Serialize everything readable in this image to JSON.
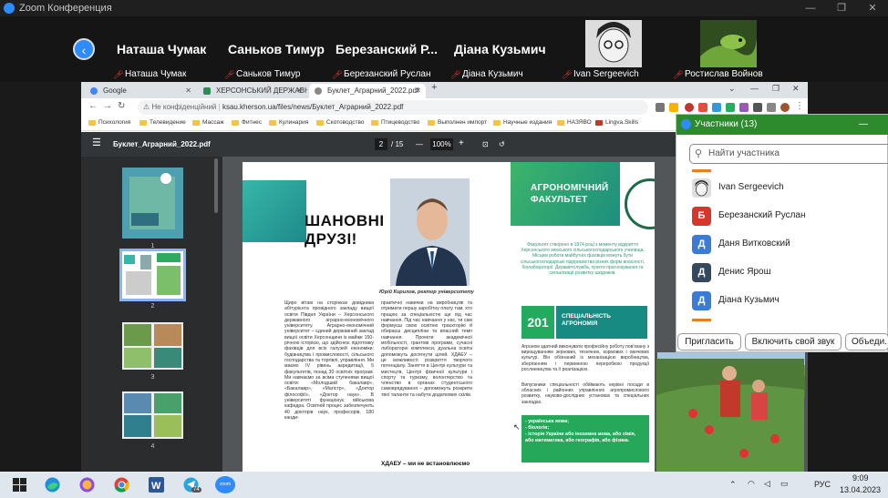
{
  "zoom": {
    "title": "Zoom Конференция"
  },
  "gallery": {
    "tiles": [
      {
        "big": "Наташа Чумак",
        "small": "Наташа Чумак"
      },
      {
        "big": "Саньков Тимур",
        "small": "Саньков Тимур"
      },
      {
        "big": "Березанский  Р...",
        "small": "Березанский Руслан"
      },
      {
        "big": "Діана Кузьмич",
        "small": "Діана Кузьмич"
      },
      {
        "big": "",
        "small": "Ivan Sergeevich"
      },
      {
        "big": "",
        "small": "Ростислав Войнов"
      }
    ]
  },
  "browser": {
    "tabs": [
      {
        "label": "Google"
      },
      {
        "label": "ХЕРСОНСЬКИЙ ДЕРЖАВНИЙ А..."
      },
      {
        "label": "Буклет_Аграрний_2022.pdf"
      }
    ],
    "address": {
      "security": "Не конфіденційний",
      "url": "ksau.kherson.ua/files/news/Буклет_Аграрний_2022.pdf"
    },
    "bookmarks": [
      "Психология",
      "Телевидение",
      "Массаж",
      "Фитнес",
      "Кулинария",
      "Скотоводство",
      "Птицеводство",
      "Выполнен импорт",
      "Научные издания",
      "НАЗЯВО",
      "Lingva.Skills"
    ]
  },
  "pdf": {
    "filename": "Буклет_Аграрний_2022.pdf",
    "current_page": "2",
    "total_pages": "/ 15",
    "zoom": "100%",
    "thumbnails": [
      "1",
      "2",
      "3",
      "4"
    ],
    "left": {
      "greeting_1": "ШАНОВНІ",
      "greeting_2": "ДРУЗІ!",
      "caption": "Юрій Кирилов, ректор університету",
      "col1": "Щиро вітаю на сторінках довідника абітурієнта провідного закладу вищої освіти Півдня України – Херсонського державного аграрно-економічного університету. Аграрно-економічний університет – єдиний державний заклад вищої освіти Херсонщини із майже 150-річною історією, що здійснює підготовку фахівців для всіх галузей економіки: будівництва і промисловості, сільського господарства та торгівлі, управління. Ми маємо IV рівень акредитації, 5 факультетів, понад 30 освітніх програм. Ми навчаємо за всіма ступенями вищої освіти: «Молодший бакалавр», «Бакалавр», «Магістр», «Доктор філософії», «Доктор наук». В університеті функціонує військова кафедра. Освітній процес забезпечують 40 докторів наук, професорів, 180 канди-",
      "col2": "практичні навички на виробництві та отримати першу заробітну плату там, хто працює за спеціальністю ще під час навчання. Під час навчання у нас, ти сам формуєш свою освітню траєкторію й обираєш дисципліни та власний темп навчання. Проекти академічної мобільності, грантові програми, сучасні лабораторні комплекси, дуальна освіта допоможуть досягнути цілей. ХДАЕУ – це можливості розкриття творчого потенціалу. Заняття в Центрі культури та мистецтв, Центрі фізичної культури і спорту та туризму, волонтерство та членство в органах студентського самоврядування – допоможуть розкрити твої таланти та набути додаткових скілів.",
      "bottom": "ХДАЕУ – ми не встановлюємо"
    },
    "right": {
      "faculty_1": "АГРОНОМІЧНИЙ",
      "faculty_2": "ФАКУЛЬТЕТ",
      "intro": "Факультет створено в 1874 році з моменту відкриття Херсонського земського сільськогосподарського училища. Місцем роботи майбутніх фахівців можуть бути сільськогосподарські підприємства різних форм власності, біолабораторії. Держветслужба, пункти прогнозування та сигналізації розвитку шкідників.",
      "spec_num": "201",
      "spec_1": "СПЕЦІАЛЬНІСТЬ",
      "spec_2": "АГРОНОМІЯ",
      "text1": "Агроном здатний виконувати професійну роботу пов'язану з вирощуванням зернових, технічних, кормових і овочевих культур. Він обізнаний із механізацією виробництва, зберіганням і первинною переробкою продукції рослинництва та її реалізацією.",
      "text2": "Випускники спеціальності обіймають керівні посади в обласних і районних управліннях агропромислового розвитку, науково-дослідних установах та спеціальних закладах.",
      "list_1": "- українська мова;",
      "list_2": "- біологія;",
      "list_3": "- історія України або іноземна мова, або хімія, або математика, або географія, або фізика."
    }
  },
  "participants": {
    "title": "Участники (13)",
    "search_placeholder": "Найти участника",
    "rows": [
      {
        "name": "Ivan Sergeevich",
        "initial": "",
        "color": "#444444"
      },
      {
        "name": "Березанский Руслан",
        "initial": "Б",
        "color": "#d9362b"
      },
      {
        "name": "Даня Витковский",
        "initial": "Д",
        "color": "#3a7bd5"
      },
      {
        "name": "Денис Ярош",
        "initial": "Д",
        "color": "#34495e"
      },
      {
        "name": "Діана Кузьмич",
        "initial": "Д",
        "color": "#3a7bd5"
      }
    ],
    "buttons": [
      "Пригласить",
      "Включить свой звук",
      "Объеди..."
    ]
  },
  "taskbar": {
    "language": "РУС",
    "time": "9:09",
    "date": "13.04.2023",
    "notif_count": "74",
    "zoom_label": "zoom"
  }
}
